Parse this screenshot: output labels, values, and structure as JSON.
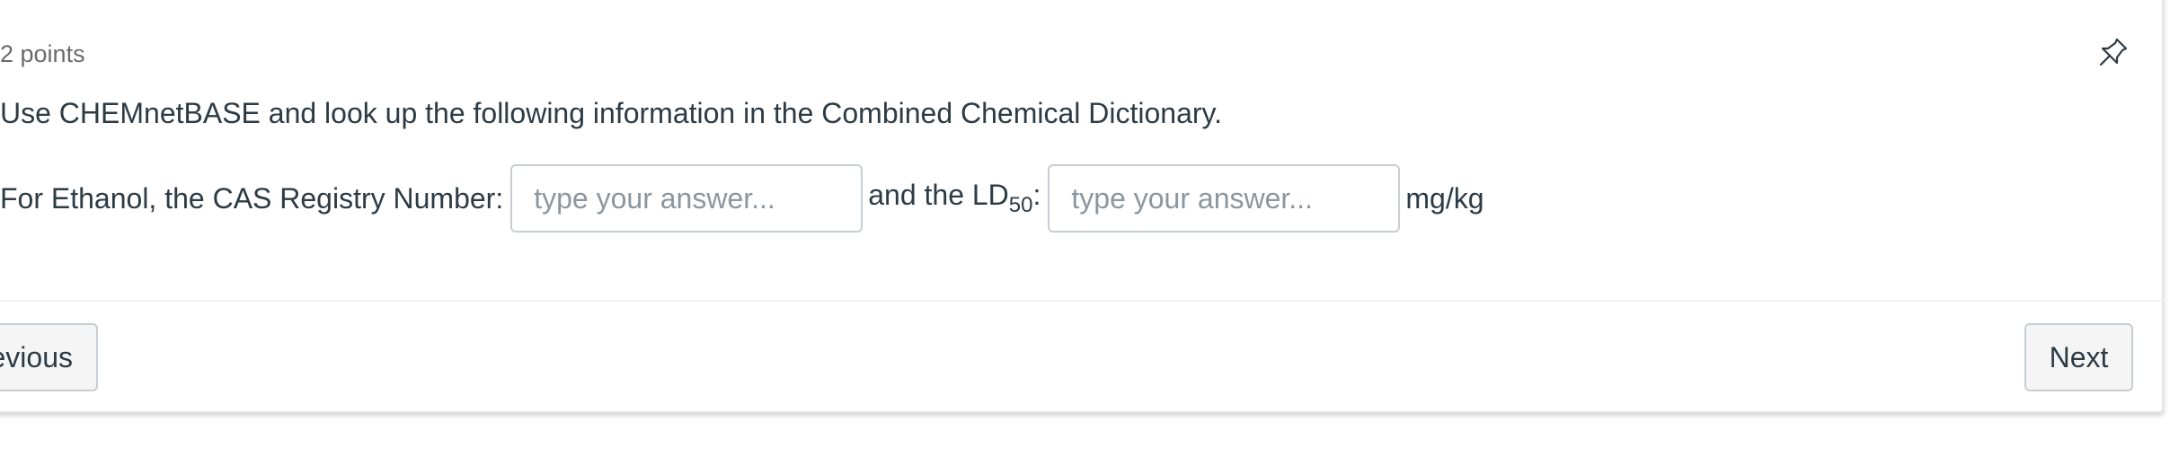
{
  "question": {
    "points": "2 points",
    "prompt": "Use CHEMnetBASE and look up the following information in the Combined Chemical Dictionary.",
    "line_prefix": "For Ethanol, the CAS Registry Number:",
    "blank1_placeholder": "type your answer...",
    "blank1_value": "",
    "middle_text": "and the LD",
    "middle_sub": "50",
    "middle_colon": ":",
    "blank2_placeholder": "type your answer...",
    "blank2_value": "",
    "unit": "mg/kg",
    "pin_icon": "pin-icon"
  },
  "navigation": {
    "previous_label": "evious",
    "next_label": "Next"
  }
}
